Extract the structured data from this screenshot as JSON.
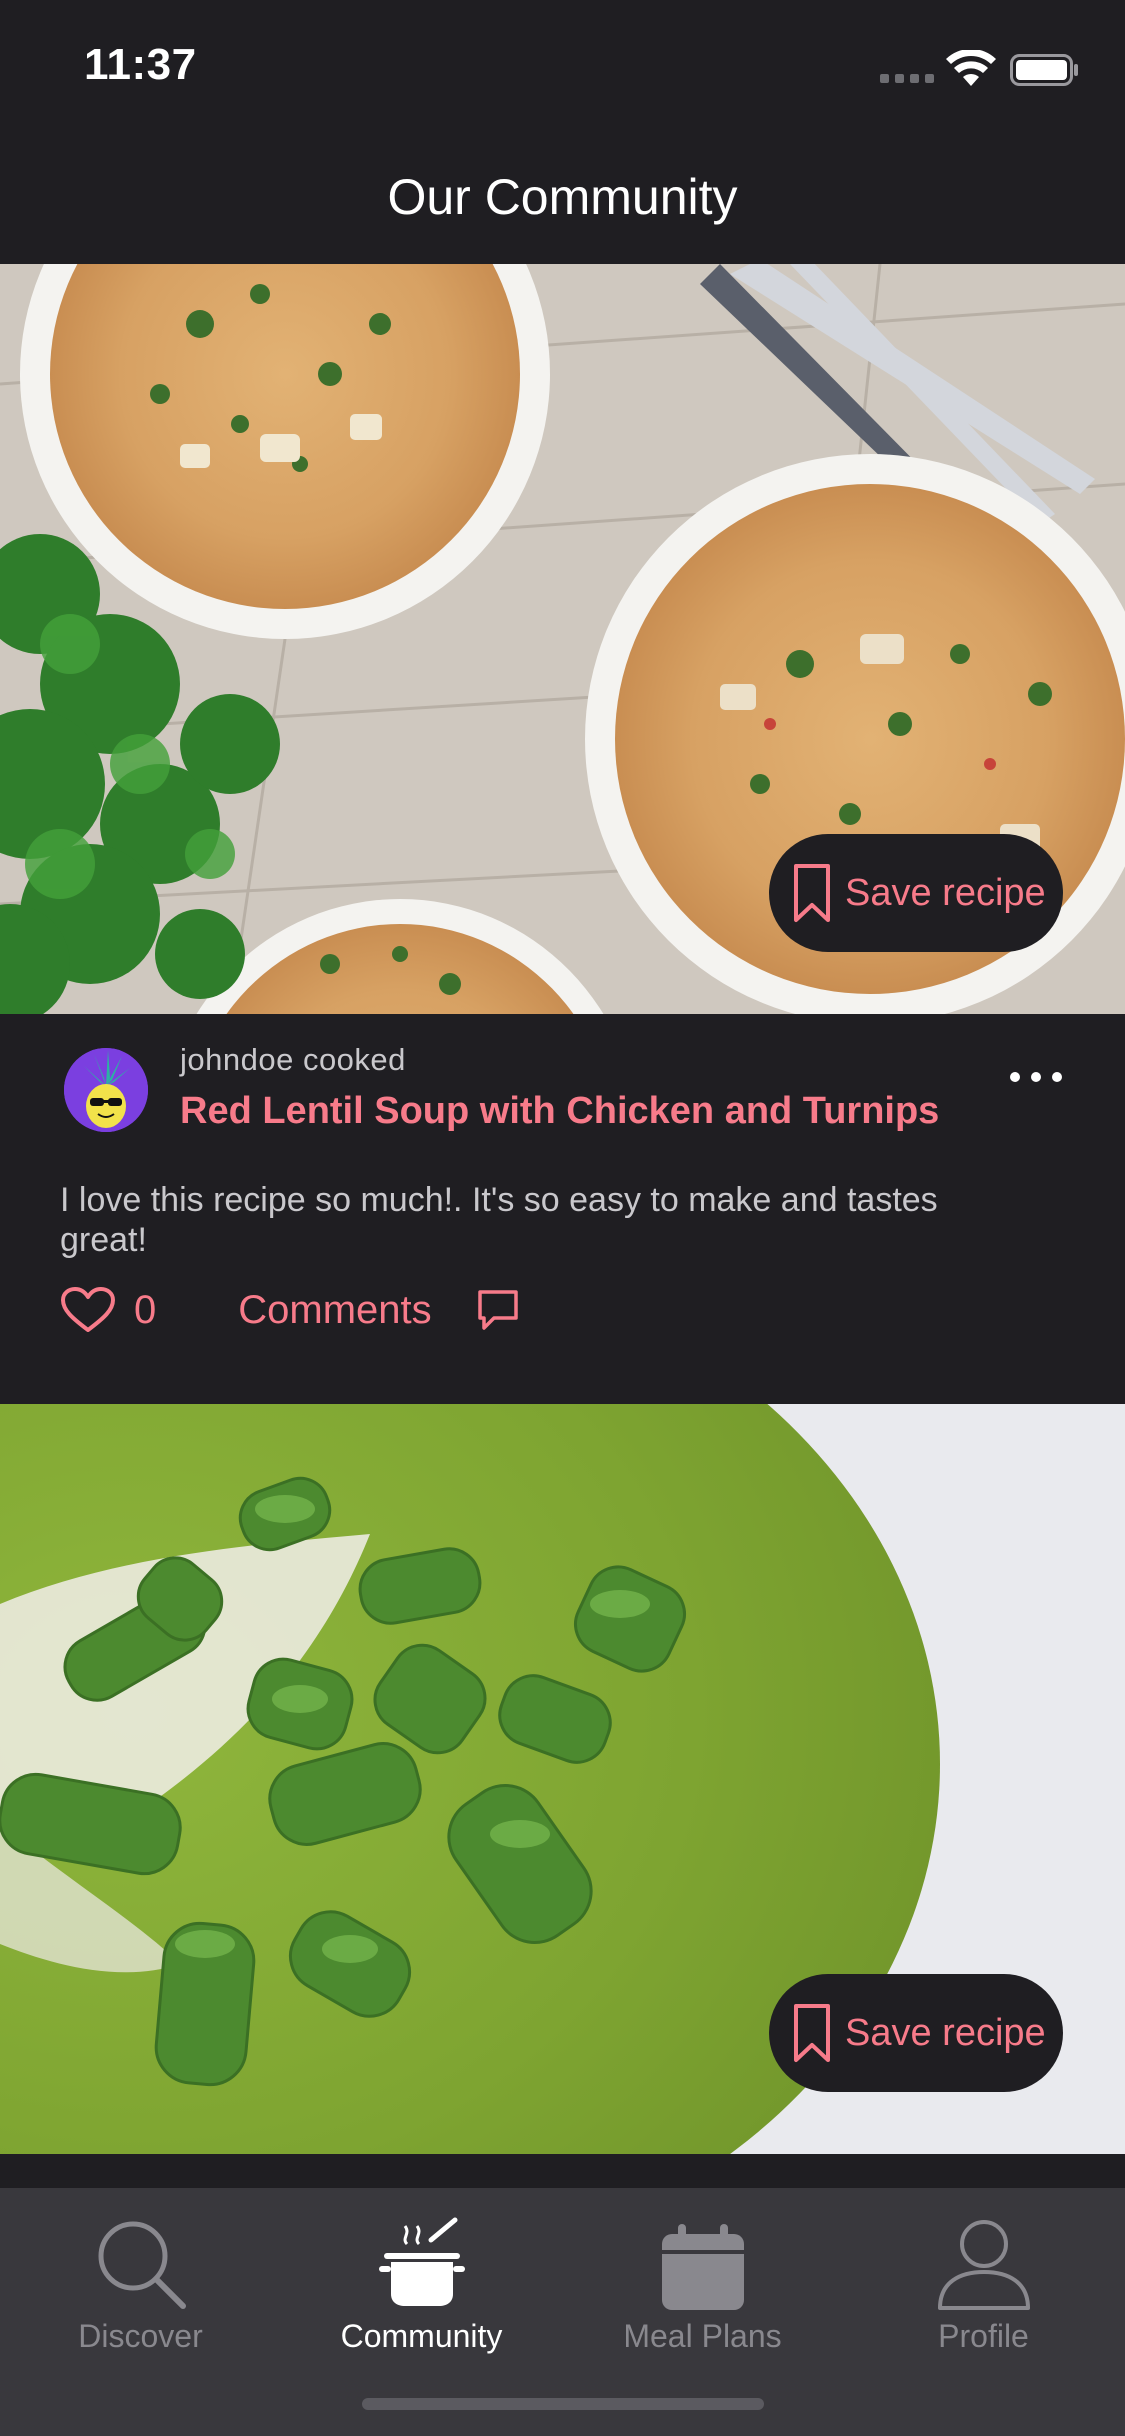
{
  "status_bar": {
    "time": "11:37"
  },
  "header": {
    "title": "Our Community"
  },
  "feed": {
    "posts": [
      {
        "save_label": "Save recipe",
        "author_line": "johndoe cooked",
        "recipe_title": "Red Lentil Soup with Chicken and Turnips",
        "caption": "I love this recipe so much!. It's so easy to make and tastes great!",
        "like_count": "0",
        "comments_label": "Comments"
      },
      {
        "save_label": "Save recipe"
      }
    ]
  },
  "tab_bar": {
    "tabs": [
      {
        "label": "Discover",
        "icon": "search-icon",
        "active": false
      },
      {
        "label": "Community",
        "icon": "cooking-pot-icon",
        "active": true
      },
      {
        "label": "Meal Plans",
        "icon": "calendar-icon",
        "active": false
      },
      {
        "label": "Profile",
        "icon": "person-icon",
        "active": false
      }
    ]
  },
  "colors": {
    "background": "#1f1e22",
    "accent": "#f77b8a",
    "tab_bar": "#39383d",
    "inactive": "#89888e"
  }
}
